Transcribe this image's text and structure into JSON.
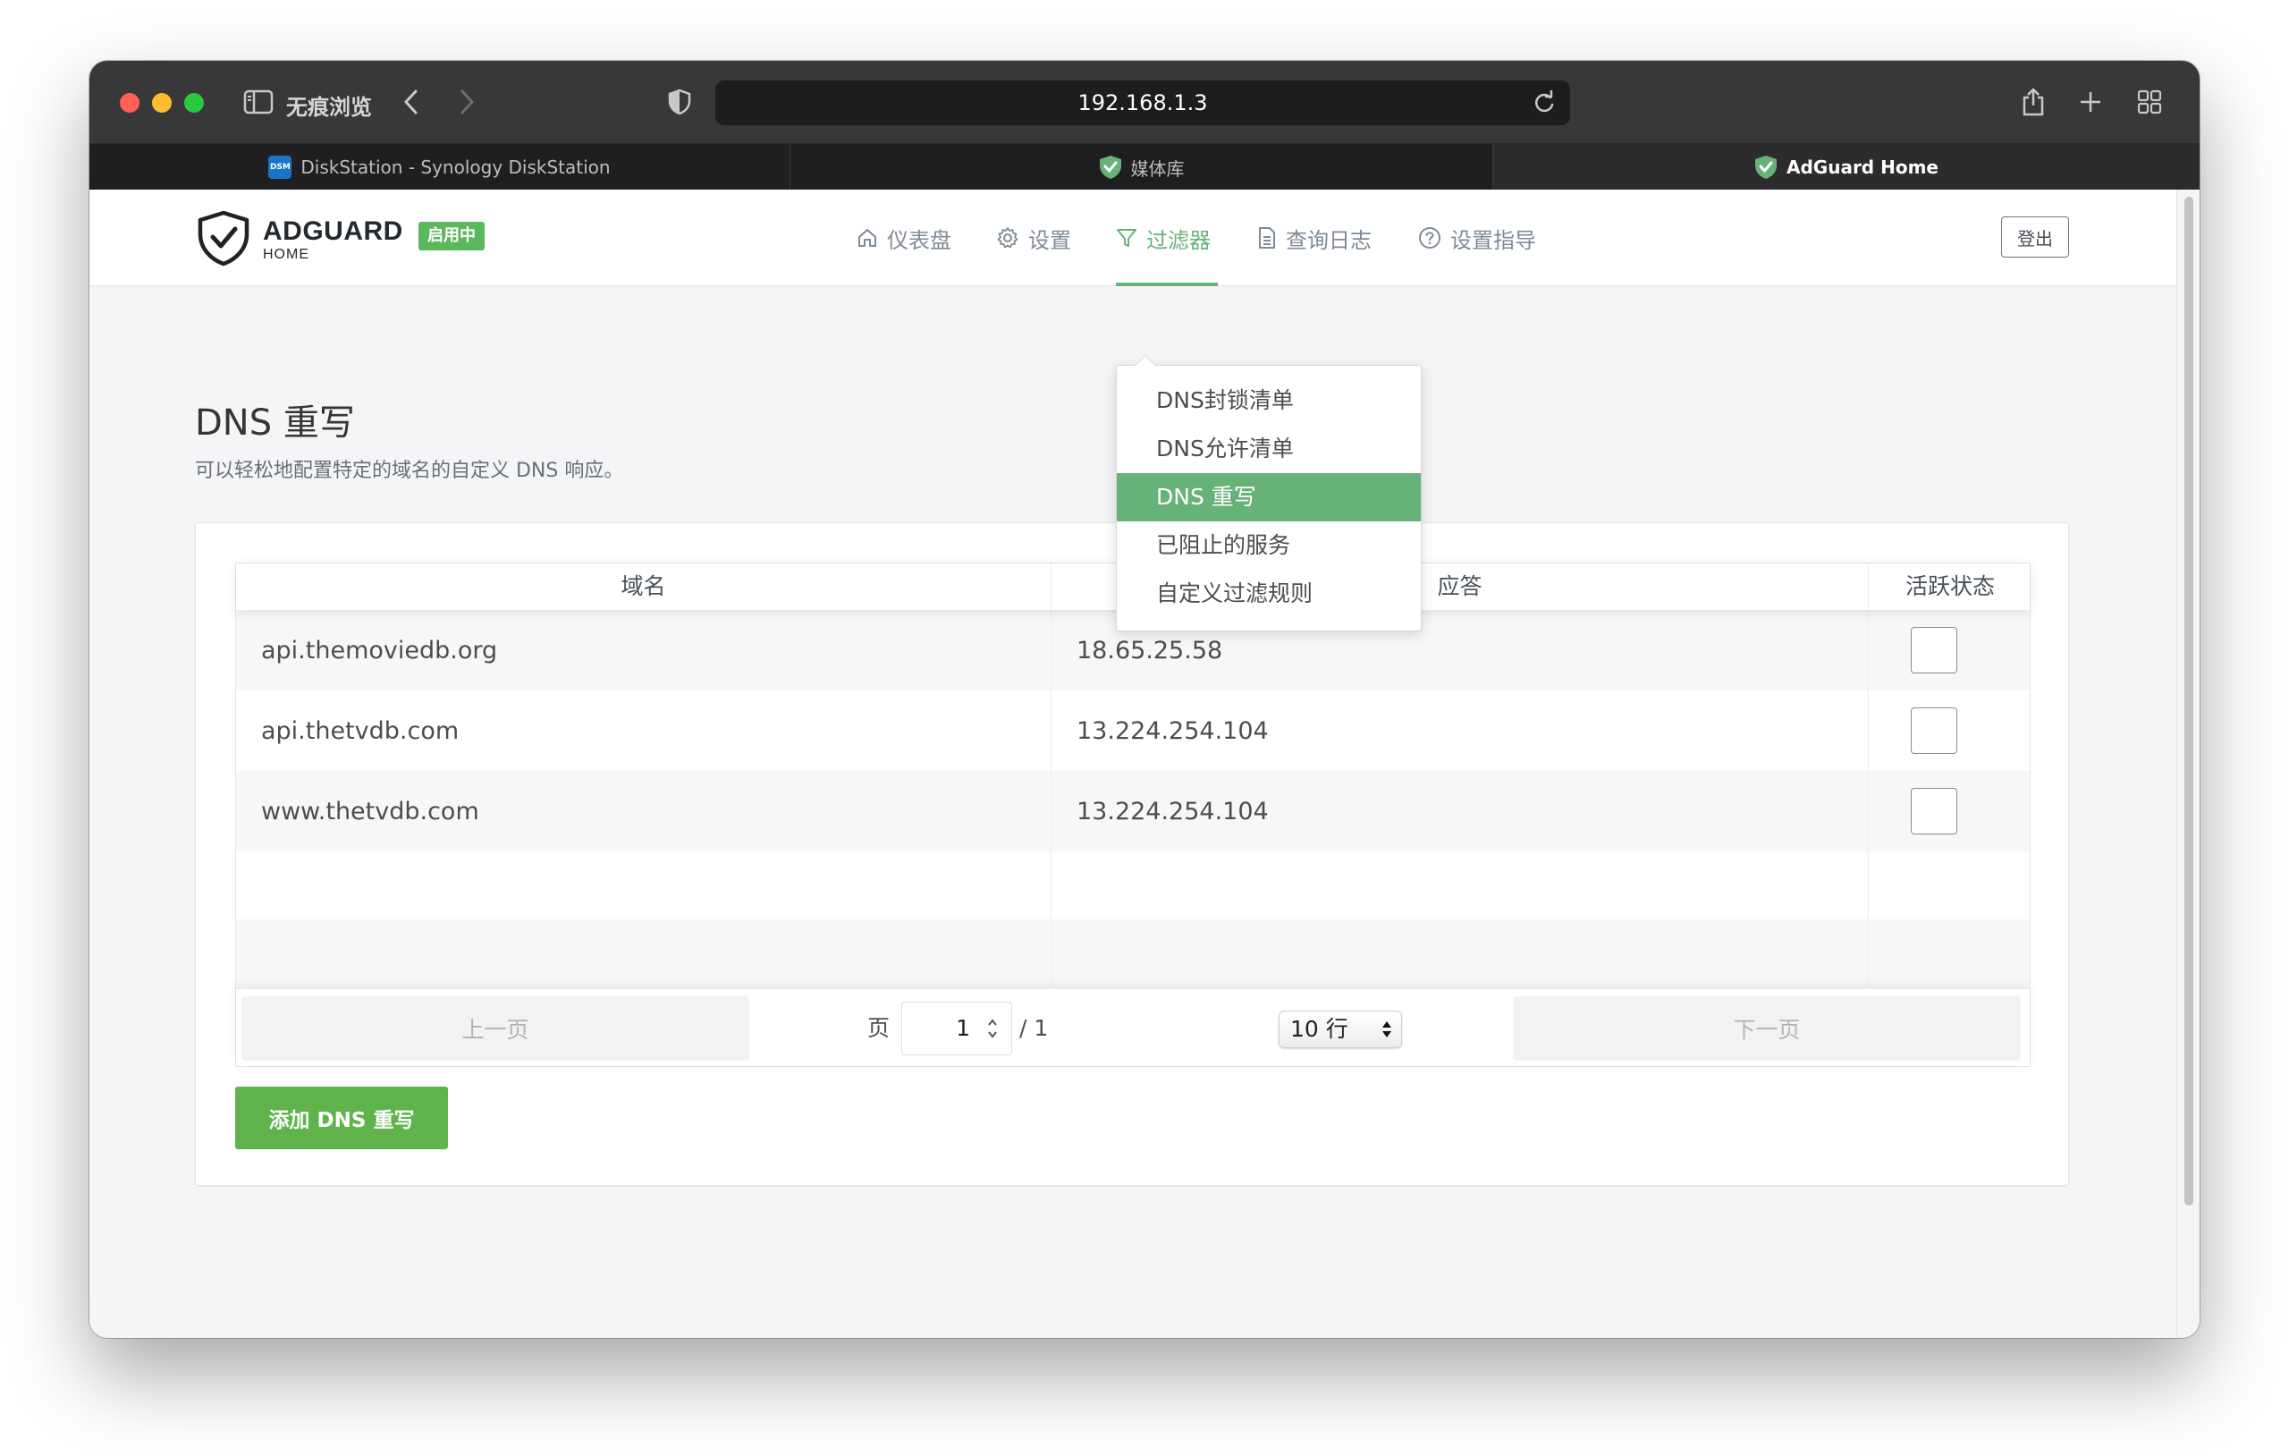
{
  "browser": {
    "private_label": "无痕浏览",
    "address": "192.168.1.3",
    "tabs": [
      {
        "label": "DiskStation - Synology DiskStation",
        "favicon": "dsm-icon",
        "favicon_text": "DSM"
      },
      {
        "label": "媒体库",
        "favicon": "adguard-shield-icon"
      },
      {
        "label": "AdGuard Home",
        "favicon": "adguard-shield-icon",
        "active": true
      }
    ]
  },
  "header": {
    "brand": "ADGUARD",
    "brand_sub": "HOME",
    "status_badge": "启用中",
    "nav": [
      {
        "label": "仪表盘",
        "icon": "home-icon"
      },
      {
        "label": "设置",
        "icon": "gear-icon"
      },
      {
        "label": "过滤器",
        "icon": "filter-icon",
        "active": true
      },
      {
        "label": "查询日志",
        "icon": "document-icon"
      },
      {
        "label": "设置指导",
        "icon": "help-circle-icon"
      }
    ],
    "logout": "登出"
  },
  "dropdown": {
    "items": [
      {
        "label": "DNS封锁清单"
      },
      {
        "label": "DNS允许清单"
      },
      {
        "label": "DNS 重写",
        "active": true
      },
      {
        "label": "已阻止的服务"
      },
      {
        "label": "自定义过滤规则"
      }
    ]
  },
  "page": {
    "title": "DNS 重写",
    "subtitle": "可以轻松地配置特定的域名的自定义 DNS 响应。"
  },
  "table": {
    "columns": [
      "域名",
      "应答",
      "活跃状态"
    ],
    "rows": [
      {
        "domain": "api.themoviedb.org",
        "answer": "18.65.25.58",
        "enabled": false
      },
      {
        "domain": "api.thetvdb.com",
        "answer": "13.224.254.104",
        "enabled": false
      },
      {
        "domain": "www.thetvdb.com",
        "answer": "13.224.254.104",
        "enabled": false
      }
    ]
  },
  "pagination": {
    "prev": "上一页",
    "page_label": "页",
    "page_value": "1",
    "total": "/ 1",
    "rows_select": "10 行",
    "next": "下一页"
  },
  "actions": {
    "add_button": "添加 DNS 重写"
  },
  "colors": {
    "accent_green": "#67b279",
    "button_green": "#5fb34a",
    "badge_green": "#5cb85c"
  }
}
